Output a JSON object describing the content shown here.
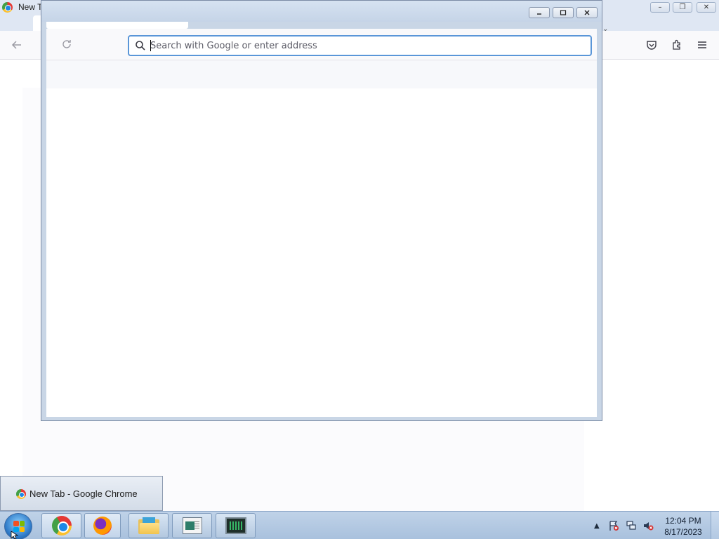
{
  "background_window": {
    "title": "New T",
    "tab_chevron": "⌄"
  },
  "dialog": {
    "url_placeholder": "Search with Google or enter address",
    "url_value": ""
  },
  "taskbar_thumbnail": {
    "label": "New Tab - Google Chrome"
  },
  "taskbar": {
    "items": [
      {
        "name": "start",
        "icon": "windows-start-icon"
      },
      {
        "name": "chrome",
        "icon": "chrome-icon"
      },
      {
        "name": "firefox",
        "icon": "firefox-icon"
      },
      {
        "name": "file-explorer",
        "icon": "folder-icon"
      },
      {
        "name": "document-app",
        "icon": "document-icon"
      },
      {
        "name": "task-manager",
        "icon": "monitor-icon"
      }
    ],
    "tray": {
      "time": "12:04 PM",
      "date": "8/17/2023"
    }
  },
  "colors": {
    "url_focus_border": "#5a96d8",
    "taskbar": "#bfd2e8"
  }
}
